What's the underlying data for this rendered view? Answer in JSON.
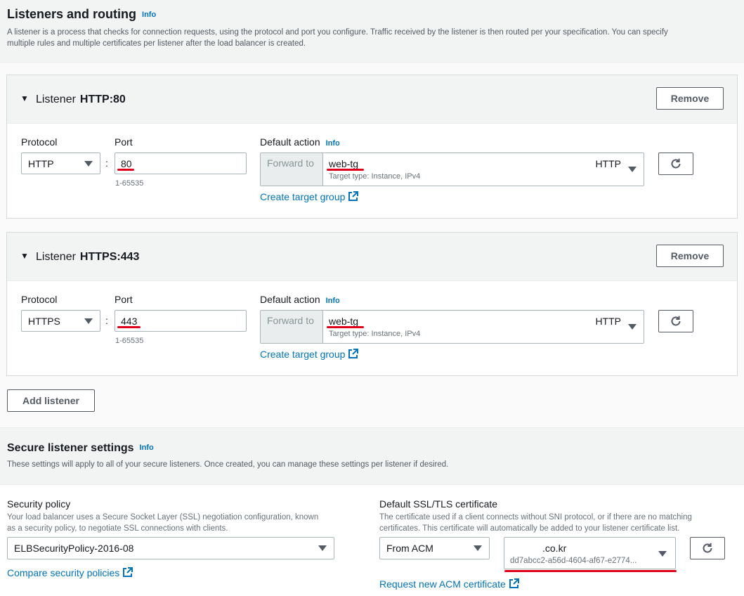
{
  "listeners_section": {
    "title": "Listeners and routing",
    "info": "Info",
    "description_line1": "A listener is a process that checks for connection requests, using the protocol and port you configure. Traffic received by the listener is then routed per your specification. You can specify",
    "description_line2": "multiple rules and multiple certificates per listener after the load balancer is created."
  },
  "listeners": [
    {
      "label": "Listener",
      "name": "HTTP:80",
      "remove": "Remove",
      "protocol_label": "Protocol",
      "protocol": "HTTP",
      "port_label": "Port",
      "port": "80",
      "port_hint": "1-65535",
      "default_action_label": "Default action",
      "info": "Info",
      "forward_to": "Forward to",
      "target_group": "web-tg",
      "target_type": "Target type: Instance, IPv4",
      "target_protocol": "HTTP",
      "create_target_group": "Create target group"
    },
    {
      "label": "Listener",
      "name": "HTTPS:443",
      "remove": "Remove",
      "protocol_label": "Protocol",
      "protocol": "HTTPS",
      "port_label": "Port",
      "port": "443",
      "port_hint": "1-65535",
      "default_action_label": "Default action",
      "info": "Info",
      "forward_to": "Forward to",
      "target_group": "web-tg",
      "target_type": "Target type: Instance, IPv4",
      "target_protocol": "HTTP",
      "create_target_group": "Create target group"
    }
  ],
  "add_listener": "Add listener",
  "secure_section": {
    "title": "Secure listener settings",
    "info": "Info",
    "description": "These settings will apply to all of your secure listeners. Once created, you can manage these settings per listener if desired."
  },
  "security_policy": {
    "label": "Security policy",
    "description_line1": "Your load balancer uses a Secure Socket Layer (SSL) negotiation configuration, known",
    "description_line2": "as a security policy, to negotiate SSL connections with clients.",
    "value": "ELBSecurityPolicy-2016-08",
    "compare_link": "Compare security policies"
  },
  "certificate": {
    "label": "Default SSL/TLS certificate",
    "description_line1": "The certificate used if a client connects without SNI protocol, or if there are no matching",
    "description_line2": "certificates. This certificate will automatically be added to your listener certificate list.",
    "source": "From ACM",
    "cert_domain": ".co.kr",
    "cert_id": "dd7abcc2-a56d-4604-af67-e2774...",
    "request_link": "Request new ACM certificate"
  },
  "colors": {
    "link": "#0073bb",
    "annotation_underline": "#e0001b",
    "panel_background": "#f2f3f3"
  }
}
